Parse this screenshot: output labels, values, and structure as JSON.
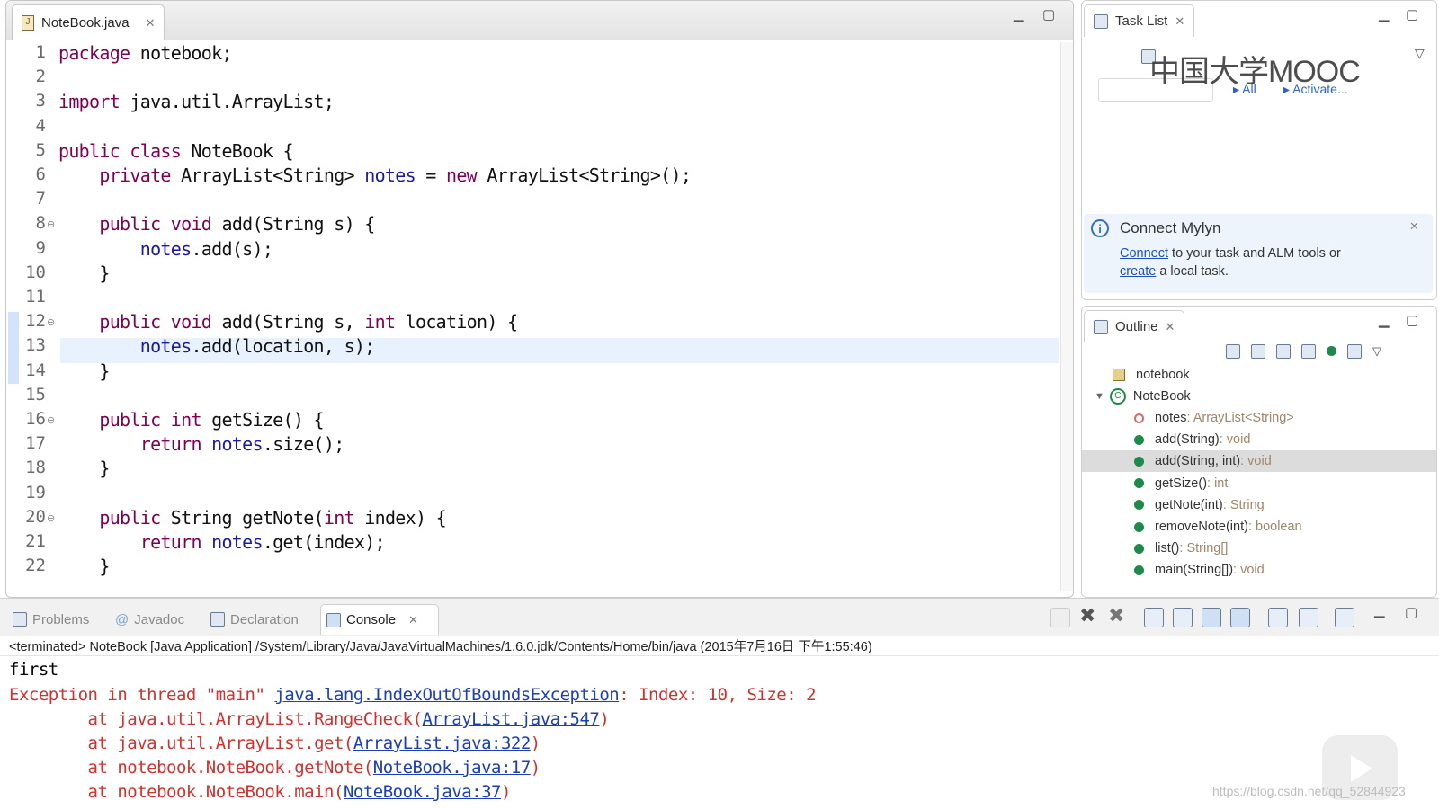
{
  "editor": {
    "tab_label": "NoteBook.java",
    "lines": [
      {
        "n": "1",
        "html": "<span class='kw'>package</span> notebook;"
      },
      {
        "n": "2",
        "html": ""
      },
      {
        "n": "3",
        "html": "<span class='kw'>import</span> java.util.ArrayList;"
      },
      {
        "n": "4",
        "html": ""
      },
      {
        "n": "5",
        "html": "<span class='kw'>public class</span> NoteBook {"
      },
      {
        "n": "6",
        "html": "    <span class='kw'>private</span> ArrayList&lt;String&gt; <span class='fld'>notes</span> = <span class='kw'>new</span> ArrayList&lt;String&gt;();"
      },
      {
        "n": "7",
        "html": ""
      },
      {
        "n": "8",
        "html": "    <span class='kw'>public void</span> add(String s) {"
      },
      {
        "n": "9",
        "html": "        <span class='fld'>notes</span>.add(s);"
      },
      {
        "n": "10",
        "html": "    }"
      },
      {
        "n": "11",
        "html": ""
      },
      {
        "n": "12",
        "html": "    <span class='kw'>public void</span> add(String s, <span class='kw'>int</span> location) {"
      },
      {
        "n": "13",
        "html": "        <span class='fld'>notes</span>.add(location, s);"
      },
      {
        "n": "14",
        "html": "    }"
      },
      {
        "n": "15",
        "html": ""
      },
      {
        "n": "16",
        "html": "    <span class='kw'>public int</span> getSize() {"
      },
      {
        "n": "17",
        "html": "        <span class='kw'>return</span> <span class='fld'>notes</span>.size();"
      },
      {
        "n": "18",
        "html": "    }"
      },
      {
        "n": "19",
        "html": ""
      },
      {
        "n": "20",
        "html": "    <span class='kw'>public</span> String getNote(<span class='kw'>int</span> index) {"
      },
      {
        "n": "21",
        "html": "        <span class='kw'>return</span> <span class='fld'>notes</span>.get(index);"
      },
      {
        "n": "22",
        "html": "    }"
      }
    ]
  },
  "tasklist": {
    "tab_label": "Task List",
    "all_label": "All",
    "activate_label": "Activate..."
  },
  "mylyn": {
    "title": "Connect Mylyn",
    "connect_link": "Connect",
    "text1": " to your task and ALM tools or",
    "create_link": "create",
    "text2": " a local task."
  },
  "outline": {
    "tab_label": "Outline",
    "package": "notebook",
    "class_name": "NoteBook",
    "members": [
      {
        "name": "notes",
        "type": " : ArrayList<String>",
        "kind": "field"
      },
      {
        "name": "add(String)",
        "type": " : void",
        "kind": "method"
      },
      {
        "name": "add(String, int)",
        "type": " : void",
        "kind": "method",
        "selected": true
      },
      {
        "name": "getSize()",
        "type": " : int",
        "kind": "method"
      },
      {
        "name": "getNote(int)",
        "type": " : String",
        "kind": "method"
      },
      {
        "name": "removeNote(int)",
        "type": " : boolean",
        "kind": "method"
      },
      {
        "name": "list()",
        "type": " : String[]",
        "kind": "method"
      },
      {
        "name": "main(String[])",
        "type": " : void",
        "kind": "method"
      }
    ]
  },
  "console": {
    "tabs": [
      "Problems",
      "Javadoc",
      "Declaration",
      "Console"
    ],
    "status": "<terminated> NoteBook [Java Application] /System/Library/Java/JavaVirtualMachines/1.6.0.jdk/Contents/Home/bin/java (2015年7月16日 下午1:55:46)",
    "out_line": "first",
    "exc_prefix": "Exception in thread \"main\" ",
    "exc_link": "java.lang.IndexOutOfBoundsException",
    "exc_suffix": ": Index: 10, Size: 2",
    "stack": [
      {
        "prefix": "        at java.util.ArrayList.RangeCheck(",
        "link": "ArrayList.java:547",
        "suffix": ")"
      },
      {
        "prefix": "        at java.util.ArrayList.get(",
        "link": "ArrayList.java:322",
        "suffix": ")"
      },
      {
        "prefix": "        at notebook.NoteBook.getNote(",
        "link": "NoteBook.java:17",
        "suffix": ")"
      },
      {
        "prefix": "        at notebook.NoteBook.main(",
        "link": "NoteBook.java:37",
        "suffix": ")"
      }
    ]
  },
  "watermark": "中国大学MOOC",
  "watermark_url": "https://blog.csdn.net/qq_52844923"
}
